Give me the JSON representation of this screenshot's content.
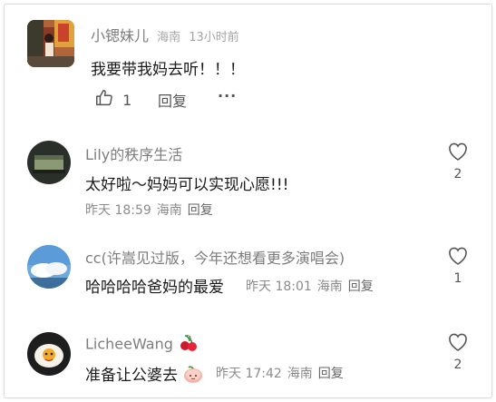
{
  "top_comment": {
    "user": "小锶妹儿",
    "location": "海南",
    "time": "13小时前",
    "text": "我要带我妈去听！！！",
    "like_count": "1",
    "reply_label": "回复",
    "more_label": "···"
  },
  "replies": [
    {
      "user": "Lily的秩序生活",
      "text": "太好啦～妈妈可以实现心愿!!!",
      "time": "昨天 18:59",
      "location": "海南",
      "reply_label": "回复",
      "like_count": "2"
    },
    {
      "user": "cc(许嵩见过版，今年还想看更多演唱会)",
      "text": "哈哈哈哈爸妈的最爱",
      "time": "昨天 18:01",
      "location": "海南",
      "reply_label": "回复",
      "like_count": "1"
    },
    {
      "user": "LicheeWang",
      "text": "准备让公婆去",
      "time": "昨天 17:42",
      "location": "海南",
      "reply_label": "回复",
      "like_count": "2"
    }
  ]
}
